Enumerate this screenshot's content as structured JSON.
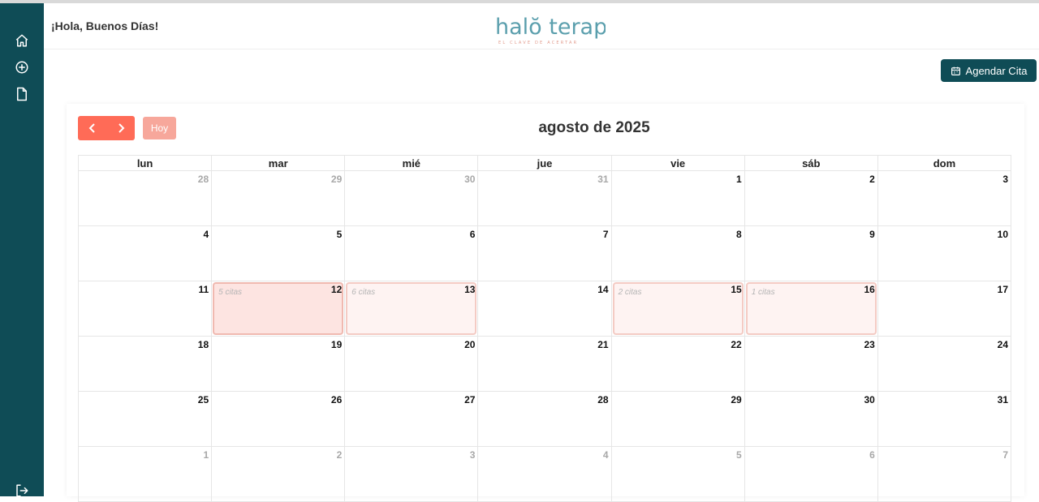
{
  "header": {
    "greeting": "¡Hola, Buenos Días!",
    "logo_text": "halŏ terapia",
    "logo_tagline": "EL CLAVE DE ACERTAR"
  },
  "sidebar": {
    "items": [
      {
        "icon": "home-icon"
      },
      {
        "icon": "plus-circle-icon"
      },
      {
        "icon": "document-icon"
      }
    ],
    "logout_icon": "logout-icon"
  },
  "toolbar": {
    "agendar_label": "Agendar Cita",
    "today_label": "Hoy",
    "month_title": "agosto de 2025"
  },
  "colors": {
    "sidebar": "#0f4c56",
    "accent": "#ff6b57",
    "accent_light": "#f7a79b"
  },
  "calendar": {
    "weekdays": [
      "lun",
      "mar",
      "mié",
      "jue",
      "vie",
      "sáb",
      "dom"
    ],
    "weeks": [
      [
        {
          "d": "28",
          "o": true
        },
        {
          "d": "29",
          "o": true
        },
        {
          "d": "30",
          "o": true
        },
        {
          "d": "31",
          "o": true
        },
        {
          "d": "1"
        },
        {
          "d": "2"
        },
        {
          "d": "3"
        }
      ],
      [
        {
          "d": "4"
        },
        {
          "d": "5"
        },
        {
          "d": "6"
        },
        {
          "d": "7"
        },
        {
          "d": "8"
        },
        {
          "d": "9"
        },
        {
          "d": "10"
        }
      ],
      [
        {
          "d": "11"
        },
        {
          "d": "12",
          "ev": "5 citas",
          "strong": true
        },
        {
          "d": "13",
          "ev": "6 citas"
        },
        {
          "d": "14"
        },
        {
          "d": "15",
          "ev": "2 citas"
        },
        {
          "d": "16",
          "ev": "1 citas"
        },
        {
          "d": "17"
        }
      ],
      [
        {
          "d": "18"
        },
        {
          "d": "19"
        },
        {
          "d": "20"
        },
        {
          "d": "21"
        },
        {
          "d": "22"
        },
        {
          "d": "23"
        },
        {
          "d": "24"
        }
      ],
      [
        {
          "d": "25"
        },
        {
          "d": "26"
        },
        {
          "d": "27"
        },
        {
          "d": "28"
        },
        {
          "d": "29"
        },
        {
          "d": "30"
        },
        {
          "d": "31"
        }
      ],
      [
        {
          "d": "1",
          "o": true
        },
        {
          "d": "2",
          "o": true
        },
        {
          "d": "3",
          "o": true
        },
        {
          "d": "4",
          "o": true
        },
        {
          "d": "5",
          "o": true
        },
        {
          "d": "6",
          "o": true
        },
        {
          "d": "7",
          "o": true
        }
      ]
    ]
  }
}
